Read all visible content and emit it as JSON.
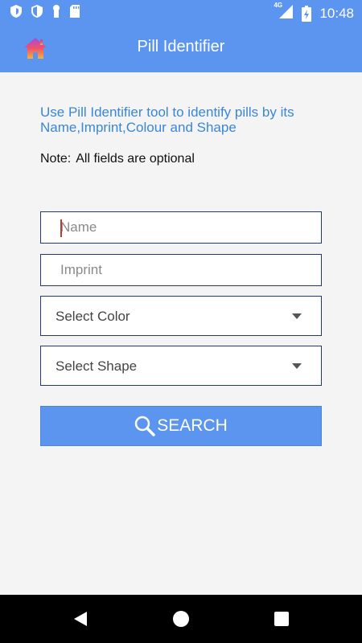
{
  "status_bar": {
    "time": "10:48",
    "network": "4G",
    "icons": [
      "shield-icon",
      "shield-half-icon",
      "keyhole-icon",
      "sd-card-icon",
      "signal-icon",
      "battery-charging-icon"
    ]
  },
  "app_bar": {
    "title": "Pill Identifier",
    "home_icon": "home-icon"
  },
  "intro": {
    "text": "Use Pill Identifier tool to identify pills by its Name,Imprint,Colour and Shape"
  },
  "note": {
    "label": "Note:",
    "text": "All fields are optional"
  },
  "form": {
    "name_placeholder": "Name",
    "imprint_placeholder": "Imprint",
    "color_select_label": "Select Color",
    "shape_select_label": "Select Shape",
    "search_label": "SEARCH"
  },
  "colors": {
    "primary": "#5b95ef",
    "intro_text": "#3a86d8",
    "field_border": "#223a6b"
  }
}
